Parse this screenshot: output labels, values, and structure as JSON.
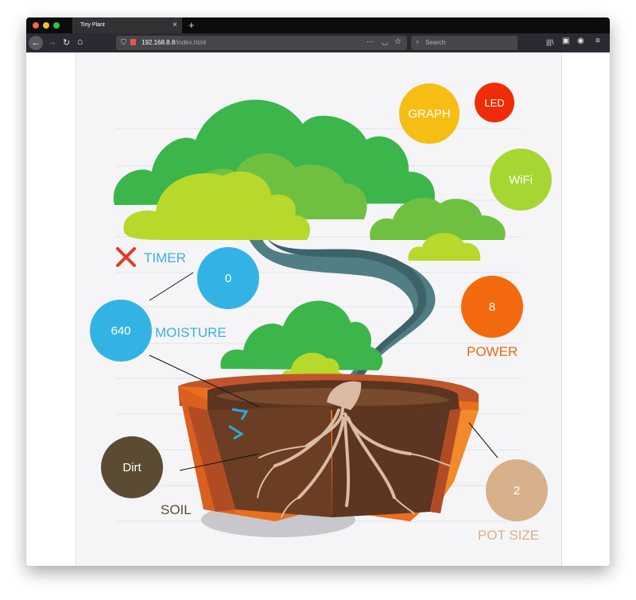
{
  "browser": {
    "tab_title": "Tiny Plant",
    "tab_close": "×",
    "new_tab": "+",
    "url_host": "192.168.8.8",
    "url_path": "/index.html",
    "search_placeholder": "Search",
    "page_actions": "···"
  },
  "plant": {
    "buttons": {
      "graph": "GRAPH",
      "led": "LED",
      "wifi": "WiFi"
    },
    "timer": {
      "label": "TIMER",
      "value": "0"
    },
    "moisture": {
      "label": "MOISTURE",
      "value": "640"
    },
    "power": {
      "label": "POWER",
      "value": "8"
    },
    "soil": {
      "label": "SOIL",
      "value": "Dirt"
    },
    "pot_size": {
      "label": "POT SIZE",
      "value": "2"
    }
  },
  "colors": {
    "graph": "#f6be14",
    "led": "#f02c08",
    "wifi": "#a6d632",
    "timer": "#33b3e4",
    "moisture": "#33b3e4",
    "power": "#f26a0d",
    "soil": "#5c4b33",
    "pot_size": "#d8b08a",
    "timer_x": "#e23b1e"
  }
}
